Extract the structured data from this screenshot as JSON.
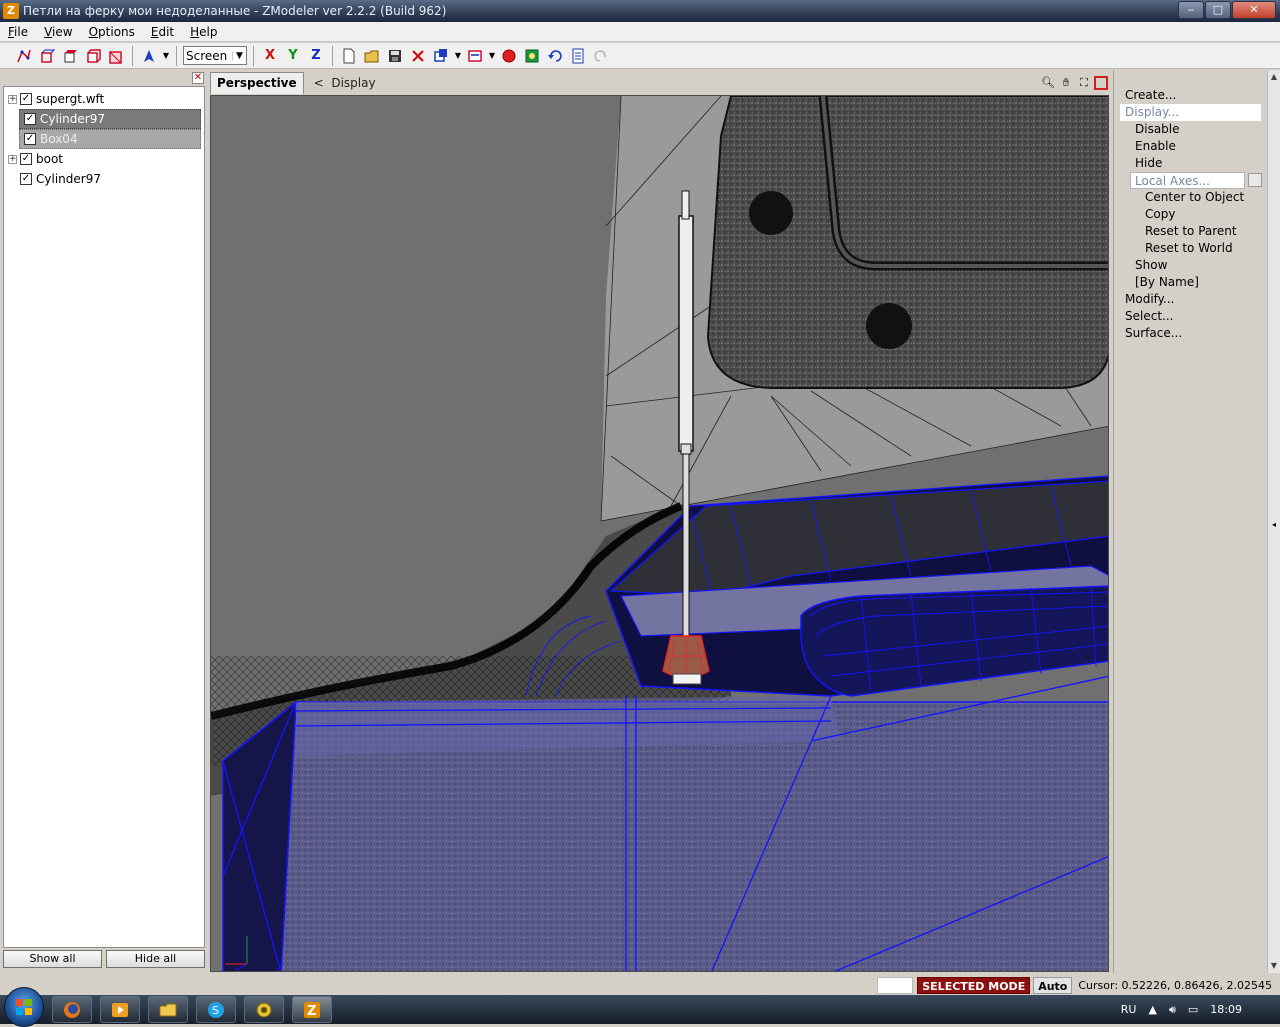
{
  "window": {
    "title": "Петли на ферку мои недоделанные - ZModeler ver 2.2.2 (Build 962)",
    "app_icon": "Z",
    "minimize": "‒",
    "maximize": "□",
    "close": "✕"
  },
  "menu": {
    "items": [
      {
        "key": "F",
        "rest": "ile"
      },
      {
        "key": "V",
        "rest": "iew"
      },
      {
        "key": "O",
        "rest": "ptions"
      },
      {
        "key": "E",
        "rest": "dit"
      },
      {
        "key": "H",
        "rest": "elp"
      }
    ]
  },
  "toolbar": {
    "coord_system": "Screen",
    "axis_x": "X",
    "axis_y": "Y",
    "axis_z": "Z"
  },
  "scene_tree": {
    "items": [
      {
        "label": "supergt.wft",
        "expandable": true,
        "checked": true
      },
      {
        "label": "Cylinder97",
        "expandable": false,
        "checked": true
      },
      {
        "label": "Box04",
        "expandable": false,
        "checked": true
      },
      {
        "label": "boot",
        "expandable": true,
        "checked": true
      },
      {
        "label": "Cylinder97",
        "expandable": false,
        "checked": true
      }
    ],
    "show_all": "Show all",
    "hide_all": "Hide all"
  },
  "viewport": {
    "tab": "Perspective",
    "breadcrumb_arrow": "<",
    "breadcrumb": "Display"
  },
  "commands": {
    "create": "Create...",
    "display": "Display...",
    "disable": "Disable",
    "enable": "Enable",
    "hide": "Hide",
    "local_axes": "Local Axes...",
    "center_to_object": "Center to Object",
    "copy": "Copy",
    "reset_to_parent": "Reset to Parent",
    "reset_to_world": "Reset to World",
    "show": "Show",
    "by_name": "[By Name]",
    "modify": "Modify...",
    "select": "Select...",
    "surface": "Surface..."
  },
  "status": {
    "mode": "SELECTED MODE",
    "auto": "Auto",
    "cursor": "Cursor: 0.52226, 0.86426, 2.02545"
  },
  "taskbar": {
    "language": "RU",
    "time": "18:09"
  },
  "colors": {
    "selected_mode_bg": "#8c1010",
    "wireframe_blue": "#1414ff",
    "viewport_bg": "#6f6f6f"
  }
}
